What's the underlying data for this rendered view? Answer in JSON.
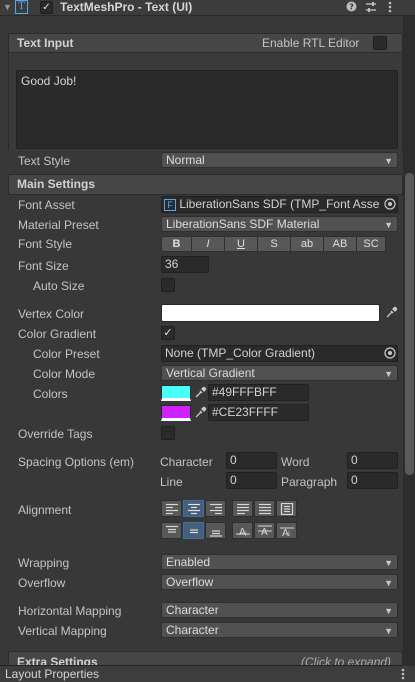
{
  "header": {
    "foldout_icon": "triangle-down",
    "component_icon": "T",
    "enabled_mark": "✓",
    "title": "TextMeshPro - Text (UI)",
    "help_icon": "?",
    "settings_icon": "⇅",
    "menu_icon": "⋮"
  },
  "text_input": {
    "section_title": "Text Input",
    "rtl_label": "Enable RTL Editor",
    "text_value": "Good Job!",
    "text_style_label": "Text Style",
    "text_style_value": "Normal"
  },
  "main_settings": {
    "section_title": "Main Settings",
    "font_asset_label": "Font Asset",
    "font_asset_value": "LiberationSans SDF (TMP_Font Asse",
    "material_preset_label": "Material Preset",
    "material_preset_value": "LiberationSans SDF Material",
    "font_style_label": "Font Style",
    "font_style_buttons": [
      "B",
      "I",
      "U",
      "S",
      "ab",
      "AB",
      "SC"
    ],
    "font_size_label": "Font Size",
    "font_size_value": "36",
    "auto_size_label": "Auto Size",
    "vertex_color_label": "Vertex Color",
    "vertex_color": "#FFFFFF",
    "color_gradient_label": "Color Gradient",
    "color_gradient_checked": "✓",
    "color_preset_label": "Color Preset",
    "color_preset_value": "None (TMP_Color Gradient)",
    "color_mode_label": "Color Mode",
    "color_mode_value": "Vertical Gradient",
    "colors_label": "Colors",
    "color1_hex": "#49FFFBFF",
    "color1": "#49FFFB",
    "color2_hex": "#CE23FFFF",
    "color2": "#CE23FF",
    "override_tags_label": "Override Tags",
    "spacing_label": "Spacing Options (em)",
    "character_label": "Character",
    "character_value": "0",
    "word_label": "Word",
    "word_value": "0",
    "line_label": "Line",
    "line_value": "0",
    "paragraph_label": "Paragraph",
    "paragraph_value": "0",
    "alignment_label": "Alignment",
    "wrapping_label": "Wrapping",
    "wrapping_value": "Enabled",
    "overflow_label": "Overflow",
    "overflow_value": "Overflow",
    "horizontal_mapping_label": "Horizontal Mapping",
    "horizontal_mapping_value": "Character",
    "vertical_mapping_label": "Vertical Mapping",
    "vertical_mapping_value": "Character"
  },
  "extra_settings": {
    "section_title": "Extra Settings",
    "hint": "(Click to expand)"
  },
  "footer": {
    "title": "Layout Properties"
  },
  "colors": {
    "accent_active": "#46607C",
    "panel_bg": "#383838"
  }
}
